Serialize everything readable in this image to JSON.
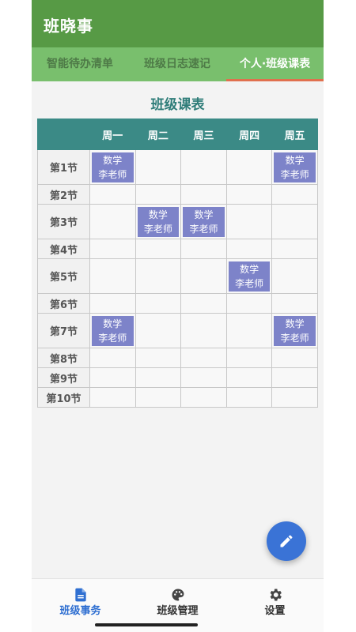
{
  "app": {
    "title": "班晓事"
  },
  "tabs": [
    {
      "label": "智能待办清单",
      "selected": false
    },
    {
      "label": "班级日志速记",
      "selected": false
    },
    {
      "label": "个人·班级课表",
      "selected": true
    }
  ],
  "schedule": {
    "title": "班级课表",
    "days": [
      "周一",
      "周二",
      "周三",
      "周四",
      "周五"
    ],
    "periods": [
      "第1节",
      "第2节",
      "第3节",
      "第4节",
      "第5节",
      "第6节",
      "第7节",
      "第8节",
      "第9节",
      "第10节"
    ],
    "course": {
      "name": "数学",
      "teacher": "李老师"
    },
    "occupied": [
      [
        0,
        0
      ],
      [
        0,
        4
      ],
      [
        2,
        1
      ],
      [
        2,
        2
      ],
      [
        4,
        3
      ],
      [
        6,
        0
      ],
      [
        6,
        4
      ]
    ],
    "tall_rows": [
      0,
      2,
      4,
      6
    ]
  },
  "fab": {
    "icon": "pencil-icon"
  },
  "bottom_nav": [
    {
      "label": "班级事务",
      "icon": "document-icon",
      "active": true
    },
    {
      "label": "班级管理",
      "icon": "palette-icon",
      "active": false
    },
    {
      "label": "设置",
      "icon": "gear-icon",
      "active": false
    }
  ],
  "colors": {
    "header": "#579a45",
    "tabbar": "#79bf6d",
    "table_header": "#3b8a86",
    "course_cell": "#7d83c9",
    "accent": "#3a73d6"
  }
}
